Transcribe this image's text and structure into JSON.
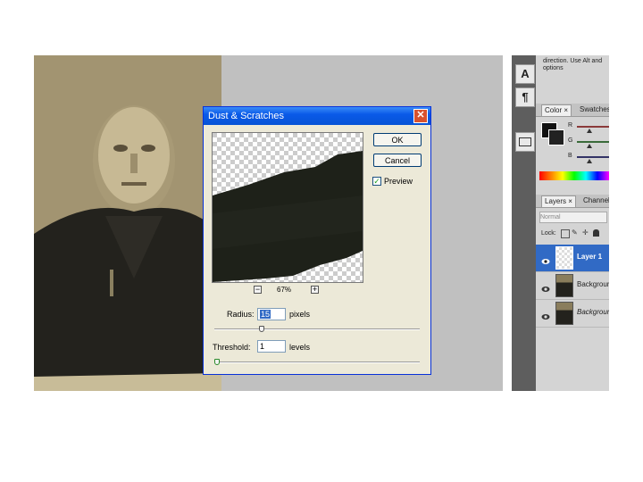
{
  "dialog": {
    "title": "Dust & Scratches",
    "ok_label": "OK",
    "cancel_label": "Cancel",
    "preview_label": "Preview",
    "preview_checked": true,
    "zoom_out_label": "−",
    "zoom_in_label": "+",
    "zoom_percent": "67%",
    "radius_label": "Radius:",
    "radius_value": "15",
    "radius_unit": "pixels",
    "threshold_label": "Threshold:",
    "threshold_value": "1",
    "threshold_unit": "levels"
  },
  "panels": {
    "hint_text_line1": "direction. Use Alt and",
    "hint_text_line2": "options",
    "tools": [
      "A",
      "¶"
    ],
    "color_tabs": [
      "Color ×",
      "Swatches"
    ],
    "color_channels": [
      "R",
      "G",
      "B"
    ],
    "layers_tabs": [
      "Layers ×",
      "Channels"
    ],
    "blend_mode": "Normal",
    "lock_label": "Lock:",
    "layers": [
      {
        "name": "Layer 1",
        "selected": true
      },
      {
        "name": "Background",
        "selected": false
      },
      {
        "name": "Background",
        "selected": false
      }
    ]
  },
  "colors": {
    "selection_blue": "#316ac5",
    "titlebar_blue": "#0a5ae8",
    "close_red": "#d8522e"
  }
}
